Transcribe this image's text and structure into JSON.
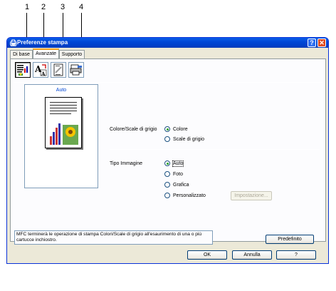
{
  "callouts": [
    "1",
    "2",
    "3",
    "4"
  ],
  "window": {
    "title": "Preferenze stampa",
    "help_label": "?",
    "close_label": "✕"
  },
  "tabs": [
    {
      "label": "Di base",
      "active": false
    },
    {
      "label": "Avanzate",
      "active": true
    },
    {
      "label": "Supporto",
      "active": false
    }
  ],
  "toolbar_icons": [
    "color-grayscale-icon",
    "scaling-icon",
    "watermark-icon",
    "device-options-icon"
  ],
  "preview": {
    "label": "Auto"
  },
  "color_group": {
    "label": "Colore/Scale di grigio",
    "options": [
      {
        "label": "Colore",
        "selected": true
      },
      {
        "label": "Scale di grigio",
        "selected": false
      }
    ]
  },
  "image_type_group": {
    "label": "Tipo Immagine",
    "options": [
      {
        "label": "Auto",
        "selected": true
      },
      {
        "label": "Foto",
        "selected": false
      },
      {
        "label": "Grafica",
        "selected": false
      },
      {
        "label": "Personalizzato",
        "selected": false
      }
    ],
    "settings_button": "Impostazione..."
  },
  "info_text": "MFC terminerà le operazione di stampa Colori/Scale di grigio all'esaurimento di una o più cartucce inchiostro.",
  "default_button": "Predefinito",
  "footer": {
    "ok": "OK",
    "cancel": "Annulla",
    "help": "?"
  },
  "colors": {
    "titlebar": "#0047d6",
    "accent": "#f0a020",
    "selection": "#21a121"
  }
}
